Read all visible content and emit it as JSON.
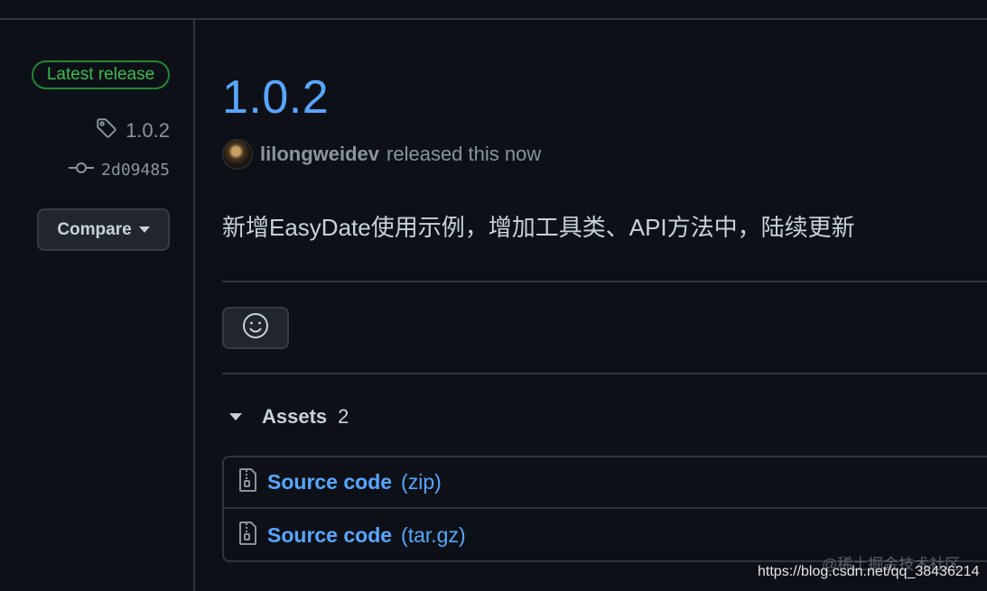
{
  "sidebar": {
    "badge": "Latest release",
    "tag": "1.0.2",
    "commit": "2d09485",
    "compare_label": "Compare"
  },
  "release": {
    "title": "1.0.2",
    "author": "lilongweidev",
    "released_text": "released this now",
    "body": "新增EasyDate使用示例，增加工具类、API方法中，陆续更新"
  },
  "assets": {
    "label": "Assets",
    "count": "2",
    "items": [
      {
        "name": "Source code",
        "ext": "(zip)"
      },
      {
        "name": "Source code",
        "ext": "(tar.gz)"
      }
    ]
  },
  "watermark": {
    "line1": "@稀土掘金技术社区",
    "line2": "https://blog.csdn.net/qq_38436214"
  },
  "colors": {
    "background": "#0d1117",
    "accent_blue": "#58a6ff",
    "badge_green": "#3fb950",
    "border": "#30363d",
    "muted": "#8b949e"
  }
}
